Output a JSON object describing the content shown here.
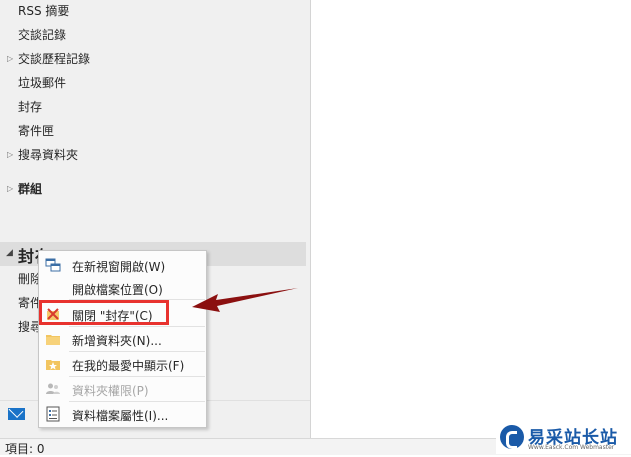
{
  "folders": [
    {
      "label": "RSS 摘要",
      "expandable": false
    },
    {
      "label": "交談記錄",
      "expandable": false
    },
    {
      "label": "交談歷程記錄",
      "expandable": true
    },
    {
      "label": "垃圾郵件",
      "expandable": false
    },
    {
      "label": "封存",
      "expandable": false
    },
    {
      "label": "寄件匣",
      "expandable": false
    },
    {
      "label": "搜尋資料夾",
      "expandable": true
    }
  ],
  "groups_label": "群組",
  "archive_section": {
    "title": "封存",
    "items": [
      "刪除",
      "寄件",
      "搜尋"
    ]
  },
  "context_menu": {
    "items": [
      {
        "label": "在新視窗開啟(W)",
        "icon": "new-window-icon",
        "disabled": false
      },
      {
        "label": "開啟檔案位置(O)",
        "icon": "",
        "disabled": false
      },
      {
        "label": "關閉 \"封存\"(C)",
        "icon": "close-folder-icon",
        "disabled": false
      },
      {
        "label": "新增資料夾(N)...",
        "icon": "new-folder-icon",
        "disabled": false
      },
      {
        "label": "在我的最愛中顯示(F)",
        "icon": "favorite-folder-icon",
        "disabled": false
      },
      {
        "label": "資料夾權限(P)",
        "icon": "permissions-icon",
        "disabled": true
      },
      {
        "label": "資料檔案屬性(I)...",
        "icon": "properties-icon",
        "disabled": false
      }
    ]
  },
  "status": {
    "items_label": "項目: 0"
  },
  "watermark": {
    "title": "易采站长站",
    "subtitle": "Www.Easck.Com Webmaster"
  },
  "colors": {
    "highlight": "#e8322e",
    "arrow": "#8b1010",
    "accent": "#1a73c8"
  }
}
